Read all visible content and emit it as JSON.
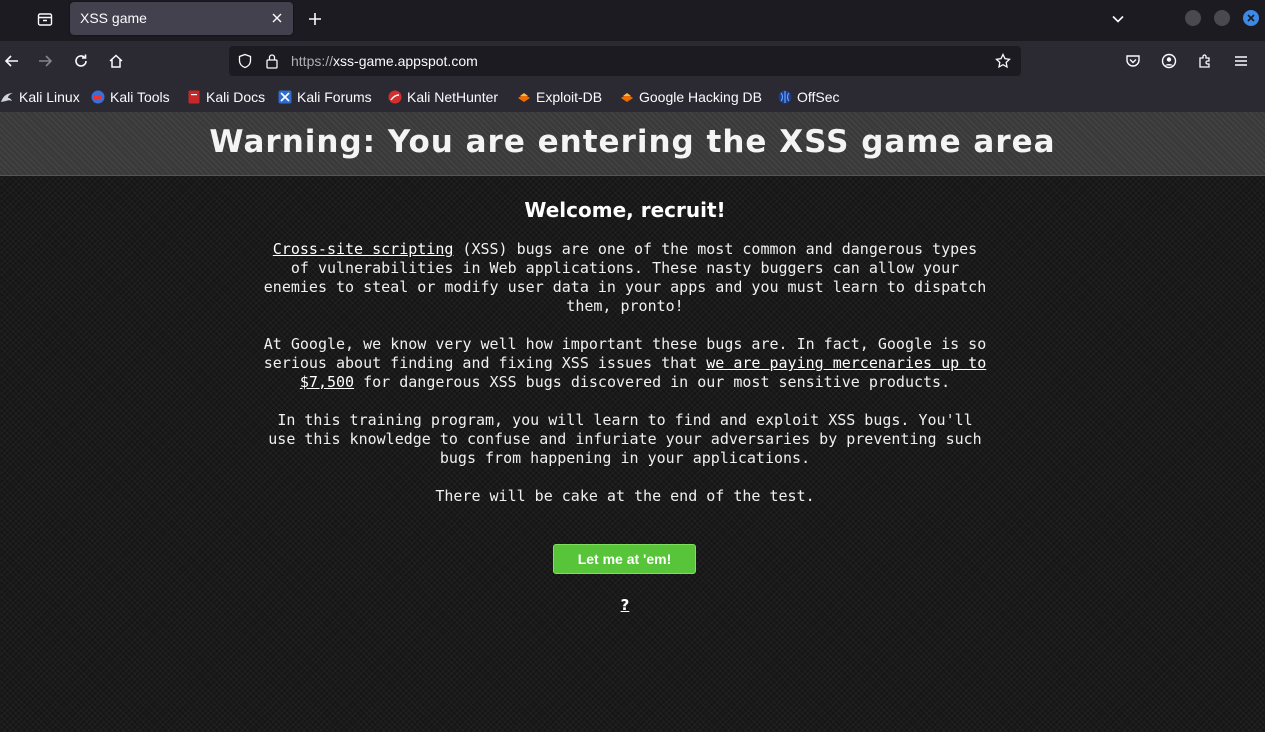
{
  "browser": {
    "tab": {
      "title": "XSS game"
    },
    "url": {
      "scheme": "https://",
      "host": "xss-game.appspot.com"
    },
    "bookmarks": [
      {
        "label": "Kali Linux",
        "icon": "kali-dragon-icon"
      },
      {
        "label": "Kali Tools",
        "icon": "kali-tools-icon"
      },
      {
        "label": "Kali Docs",
        "icon": "kali-docs-icon"
      },
      {
        "label": "Kali Forums",
        "icon": "kali-forums-icon"
      },
      {
        "label": "Kali NetHunter",
        "icon": "kali-nethunter-icon"
      },
      {
        "label": "Exploit-DB",
        "icon": "exploit-db-icon"
      },
      {
        "label": "Google Hacking DB",
        "icon": "ghdb-icon"
      },
      {
        "label": "OffSec",
        "icon": "offsec-icon"
      }
    ]
  },
  "page": {
    "banner_title": "Warning: You are entering the XSS game area",
    "welcome": "Welcome, recruit!",
    "p1": {
      "link": "Cross-site scripting",
      "rest": " (XSS) bugs are one of the most common and dangerous types of vulnerabilities in Web applications. These nasty buggers can allow your enemies to steal or modify user data in your apps and you must learn to dispatch them, pronto!"
    },
    "p2": {
      "before": "At Google, we know very well how important these bugs are. In fact, Google is so serious about finding and fixing XSS issues that ",
      "link": "we are paying mercenaries up to $7,500",
      "after": " for dangerous XSS bugs discovered in our most sensitive products."
    },
    "p3": "In this training program, you will learn to find and exploit XSS bugs. You'll use this knowledge to confuse and infuriate your adversaries by preventing such bugs from happening in your applications.",
    "p4": "There will be cake at the end of the test.",
    "cta_label": "Let me at 'em!",
    "help_label": "?"
  },
  "colors": {
    "accent_button": "#57c43a",
    "window_close": "#3d8ae6"
  }
}
